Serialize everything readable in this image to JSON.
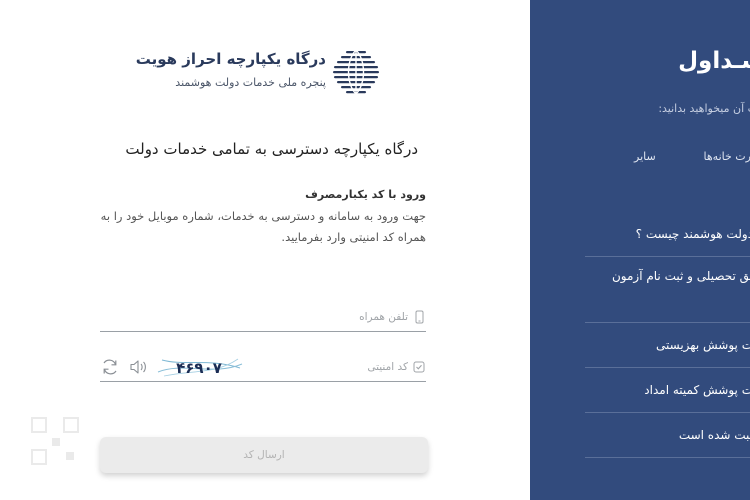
{
  "brand": {
    "title": "درگاه یکپارچه احراز هویت",
    "subtitle": "پنجره ملی خدمات دولت هوشمند"
  },
  "login": {
    "heading": "درگاه یکپارچه دسترسی به تمامی خدمات دولت",
    "otp_title": "ورود با کد یکبارمصرف",
    "otp_description": "جهت ورود به سامانه و دسترسی به خدمات، شماره موبایل خود را به همراه کد امنیتی وارد بفرمایید.",
    "phone_placeholder": "تلفن همراه",
    "captcha_placeholder": "کد امنیتی",
    "captcha_code": "۴۶۹۰۷",
    "submit_label": "ارسال کد"
  },
  "info": {
    "heading": "سـداول",
    "subheading": "ت آن میخواهید بدانید:",
    "tabs": [
      "ارت خانه‌ها",
      "سایر"
    ],
    "faq": [
      "دولت هوشمند چیست ؟",
      "بق تحصیلی و ثبت نام آزمون",
      "ت پوشش بهزیستی",
      "ت پوشش کمیته امداد",
      "ثبت شده است"
    ]
  },
  "colors": {
    "panel_blue": "#324b7d",
    "brand_navy": "#2a3a5c",
    "button_disabled": "#ebebeb"
  },
  "icons": {
    "logo": "globe-stripes-icon",
    "phone": "mobile-phone-icon",
    "captcha": "check-square-icon",
    "sound": "speaker-icon",
    "refresh": "refresh-icon"
  }
}
